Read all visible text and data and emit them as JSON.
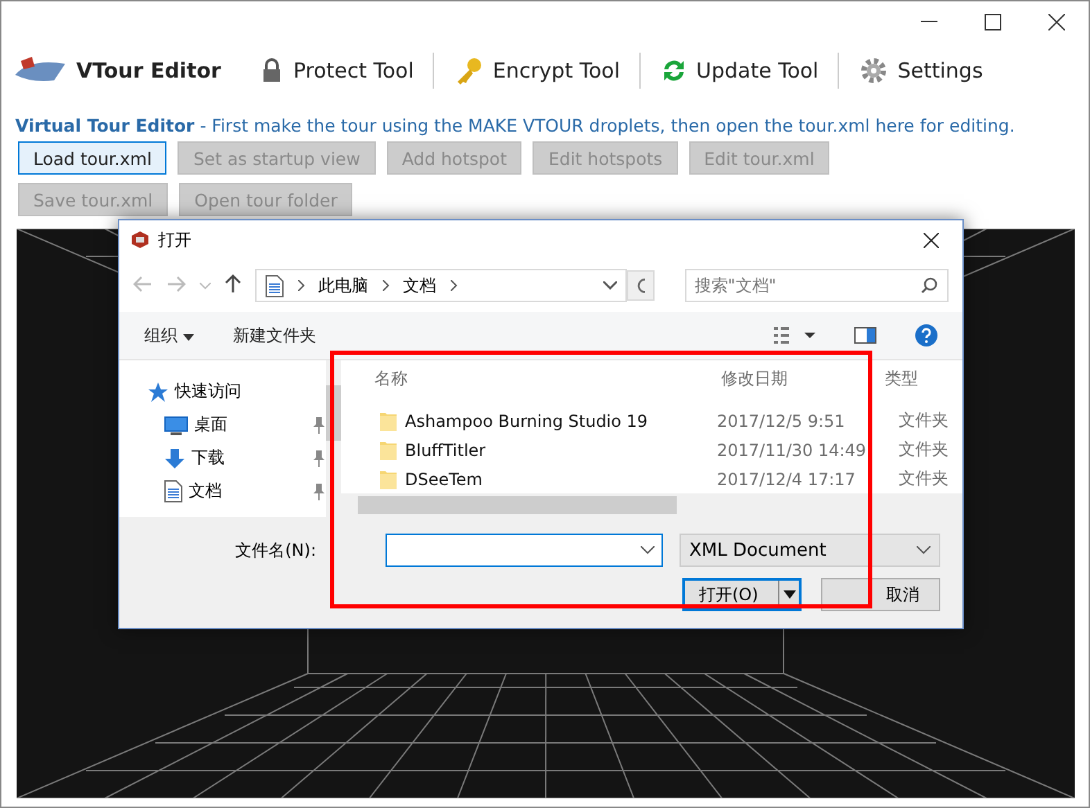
{
  "toolbar": [
    {
      "label": "VTour Editor",
      "selected": true
    },
    {
      "label": "Protect Tool",
      "selected": false
    },
    {
      "label": "Encrypt Tool",
      "selected": false
    },
    {
      "label": "Update Tool",
      "selected": false
    },
    {
      "label": "Settings",
      "selected": false
    }
  ],
  "description": {
    "title": "Virtual Tour Editor",
    "text": " - First make the tour using the MAKE VTOUR droplets, then open the tour.xml here for editing."
  },
  "actions": [
    {
      "label": "Load tour.xml",
      "disabled": false
    },
    {
      "label": "Set as startup view",
      "disabled": true
    },
    {
      "label": "Add hotspot",
      "disabled": true
    },
    {
      "label": "Edit hotspots",
      "disabled": true
    },
    {
      "label": "Edit tour.xml",
      "disabled": true
    },
    {
      "label": "Save tour.xml",
      "disabled": true
    },
    {
      "label": "Open tour folder",
      "disabled": true
    }
  ],
  "dialog": {
    "title": "打开",
    "breadcrumb": [
      "此电脑",
      "文档"
    ],
    "search": {
      "placeholder": "搜索\"文档\""
    },
    "commands": [
      "组织",
      "新建文件夹"
    ],
    "nav": [
      {
        "label": "快速访问",
        "pinned": false
      },
      {
        "label": "桌面",
        "pinned": true
      },
      {
        "label": "下载",
        "pinned": true
      },
      {
        "label": "文档",
        "pinned": true
      }
    ],
    "columns": [
      "名称",
      "修改日期",
      "类型"
    ],
    "files": [
      {
        "name": "Ashampoo Burning Studio 19",
        "date": "2017/12/5 9:51",
        "type": "文件夹"
      },
      {
        "name": "BluffTitler",
        "date": "2017/11/30 14:49",
        "type": "文件夹"
      },
      {
        "name": "DSeeTem",
        "date": "2017/12/4 17:17",
        "type": "文件夹"
      }
    ],
    "filename_label": "文件名(N):",
    "filetype": "XML Document",
    "open_button": "打开(O)",
    "cancel_button": "取消"
  }
}
